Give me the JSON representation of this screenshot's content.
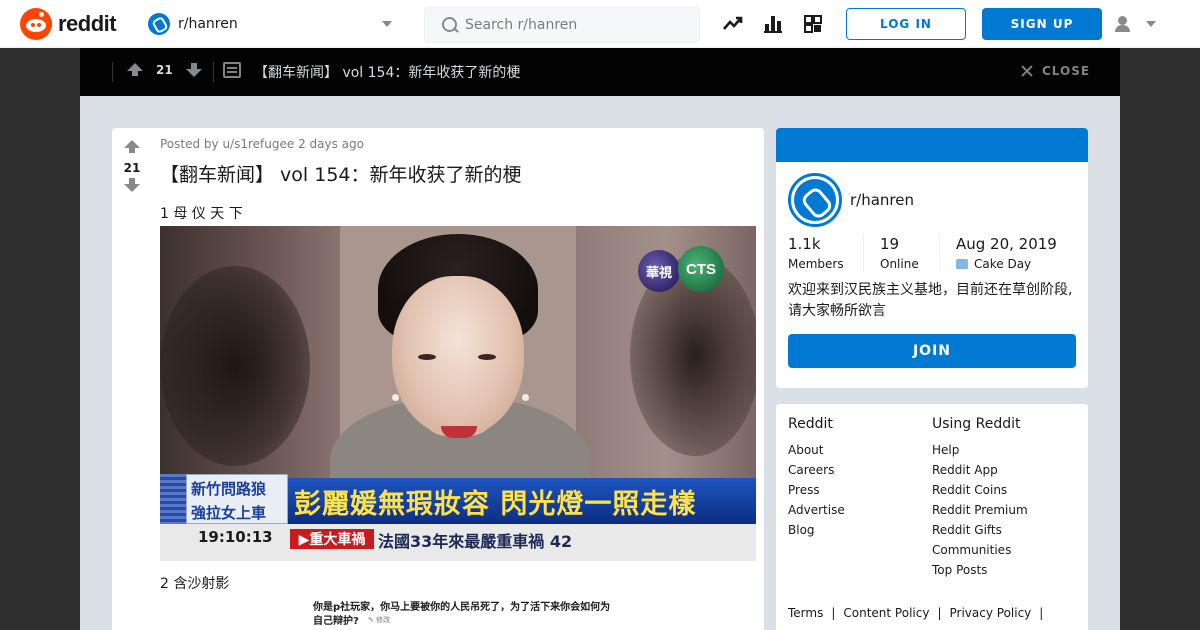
{
  "header": {
    "logo_text": "reddit",
    "community": "r/hanren",
    "search_placeholder": "Search r/hanren",
    "login_label": "LOG IN",
    "signup_label": "SIGN UP",
    "icons": [
      "trending-icon",
      "stats-icon",
      "coins-icon"
    ]
  },
  "postbar": {
    "score": "21",
    "title": "【翻车新闻】 vol 154：新年收获了新的梗",
    "close_label": "CLOSE"
  },
  "post": {
    "score": "21",
    "meta": "Posted by u/s1refugee 2 days ago",
    "title": "【翻车新闻】 vol 154：新年收获了新的梗",
    "item1": "1 母 仪 天 下",
    "item2": "2 含沙射影",
    "image1": {
      "logo_left": "華視",
      "logo_right": "CTS",
      "sub_line1": "新竹問路狼",
      "sub_line2": "強拉女上車",
      "headline": "彭麗媛無瑕妝容 閃光燈一照走樣",
      "time": "19:10:13",
      "red_tag": "▶重大車禍",
      "ticker": "法國33年來最嚴重車禍  42"
    },
    "image2": {
      "line1": "你是p社玩家，你马上要被你的人民吊死了，为了活下来你会如何为",
      "line2": "自己辩护?",
      "edit_label": "✎ 修改"
    }
  },
  "about": {
    "name": "r/hanren",
    "members_value": "1.1k",
    "members_label": "Members",
    "online_value": "19",
    "online_label": "Online",
    "cake_value": "Aug 20, 2019",
    "cake_label": "Cake Day",
    "description": "欢迎来到汉民族主义基地，目前还在草创阶段,请大家畅所欲言",
    "join_label": "JOIN"
  },
  "footer": {
    "col1_head": "Reddit",
    "col1_links": [
      "About",
      "Careers",
      "Press",
      "Advertise",
      "Blog"
    ],
    "col2_head": "Using Reddit",
    "col2_links": [
      "Help",
      "Reddit App",
      "Reddit Coins",
      "Reddit Premium",
      "Reddit Gifts",
      "Communities",
      "Top Posts"
    ],
    "bottom_links": [
      "Terms",
      "Content Policy",
      "Privacy Policy"
    ]
  }
}
